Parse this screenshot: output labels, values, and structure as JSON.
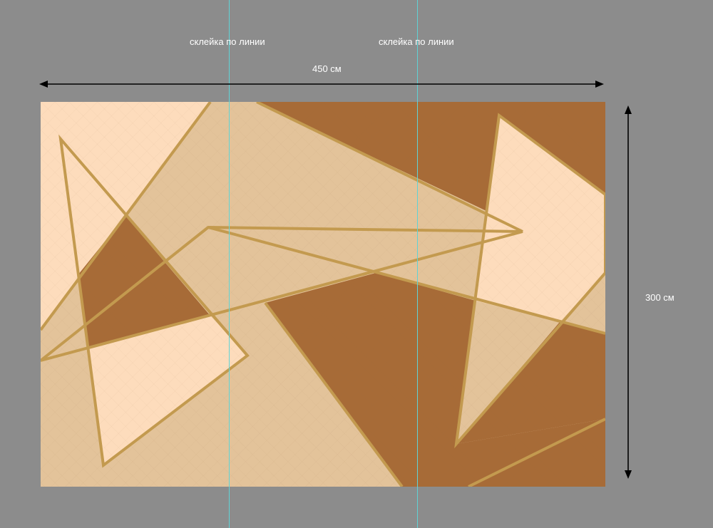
{
  "seam_label": "склейка по линии",
  "width_label": "450 см",
  "height_label": "300 см",
  "colors": {
    "background": "#8c8c8c",
    "light": "#fddcbc",
    "medium": "#e3c39a",
    "dark": "#a76b37",
    "outline": "#c39a4f",
    "seam": "#5fd3d6",
    "dimension": "#000000"
  }
}
